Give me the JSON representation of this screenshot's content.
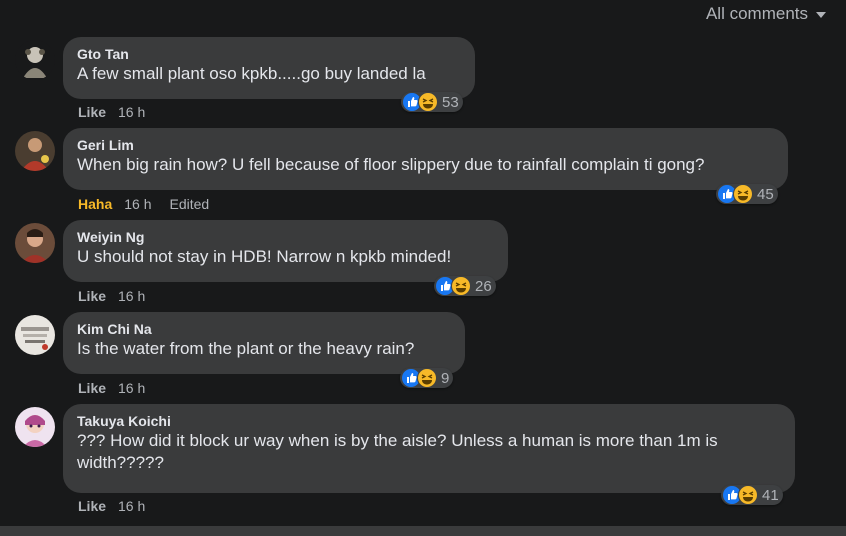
{
  "filter": {
    "label": "All comments"
  },
  "comments": [
    {
      "author": "Gto Tan",
      "text": "A few small plant oso kpkb.....go buy landed la",
      "action": "Like",
      "time": "16 h",
      "edited": "",
      "reactions": "53"
    },
    {
      "author": "Geri Lim",
      "text": "When big rain how? U fell because of floor slippery due to rainfall complain ti gong?",
      "action": "Haha",
      "time": "16 h",
      "edited": "Edited",
      "reactions": "45"
    },
    {
      "author": "Weiyin Ng",
      "text": "U should not stay in HDB! Narrow n kpkb minded!",
      "action": "Like",
      "time": "16 h",
      "edited": "",
      "reactions": "26"
    },
    {
      "author": "Kim Chi Na",
      "text": "Is the water from the plant or the heavy rain?",
      "action": "Like",
      "time": "16 h",
      "edited": "",
      "reactions": "9"
    },
    {
      "author": "Takuya Koichi",
      "text": "??? How did it block ur way when is by the aisle? Unless a human is more than 1m is width?????",
      "action": "Like",
      "time": "16 h",
      "edited": "",
      "reactions": "41"
    }
  ],
  "colors": {
    "background": "#18191a",
    "bubble": "#3a3b3c",
    "haha": "#f7b928",
    "like": "#1877f2"
  },
  "icons": {
    "reaction_like": "like-reaction-icon",
    "reaction_haha": "haha-reaction-icon"
  }
}
